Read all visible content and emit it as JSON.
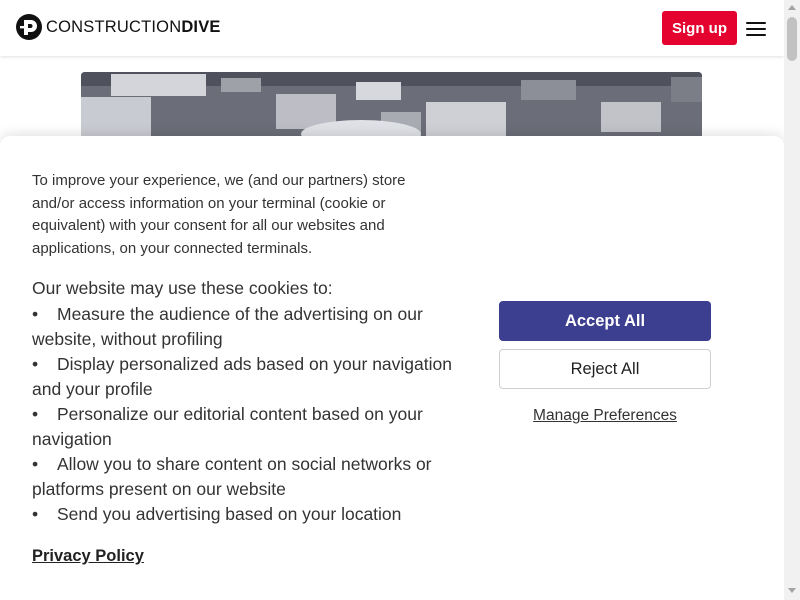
{
  "header": {
    "logo_light": "CONSTRUCTION",
    "logo_bold": "DIVE",
    "signup_label": "Sign up",
    "brand_color": "#e4032e"
  },
  "consent": {
    "intro": "To improve your experience, we (and our partners) store and/or access information on your terminal (cookie or equivalent) with your consent for all our websites and applications, on your connected terminals.",
    "uses_heading": "Our website may use these cookies to:",
    "uses": [
      "Measure the audience of the advertising on our website, without profiling",
      "Display personalized ads based on your navigation and your profile",
      "Personalize our editorial content based on your navigation",
      "Allow you to share content on social networks or platforms present on our website",
      "Send you advertising based on your location"
    ],
    "privacy_label": "Privacy Policy",
    "accept_label": "Accept All",
    "reject_label": "Reject All",
    "manage_label": "Manage Preferences",
    "accept_color": "#3c3e8f"
  },
  "icons": {
    "logo": "construction-dive-logo-icon",
    "menu": "hamburger-menu-icon"
  }
}
